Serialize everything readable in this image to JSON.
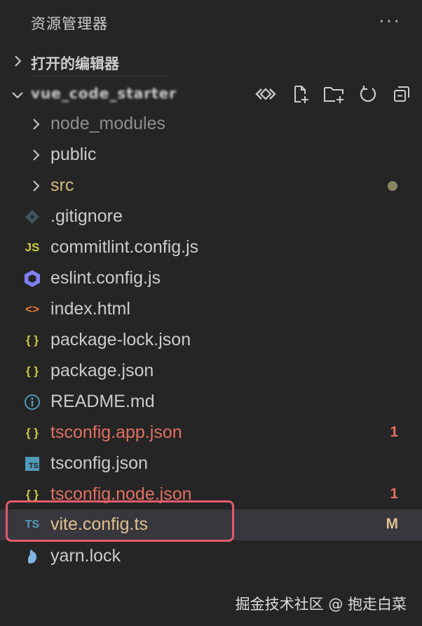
{
  "header": {
    "title": "资源管理器",
    "more_icon": "more-dots-icon"
  },
  "open_editors": {
    "label": "打开的编辑器"
  },
  "project": {
    "title": "vue_code_starter"
  },
  "toolbar": {
    "icons": [
      "source-control-icon",
      "new-file-icon",
      "new-folder-icon",
      "refresh-icon",
      "collapse-all-icon"
    ]
  },
  "tree": [
    {
      "type": "folder",
      "label": "node_modules",
      "color": "#8e8e8e"
    },
    {
      "type": "folder",
      "label": "public",
      "color": "#cccccc"
    },
    {
      "type": "folder",
      "label": "src",
      "color": "#d7ba7d",
      "modified_dot": true
    },
    {
      "type": "file",
      "label": ".gitignore",
      "icon": "git-icon",
      "color": "#cccccc"
    },
    {
      "type": "file",
      "label": "commitlint.config.js",
      "icon": "js-icon",
      "icon_text": "JS",
      "color": "#cccccc"
    },
    {
      "type": "file",
      "label": "eslint.config.js",
      "icon": "eslint-icon",
      "color": "#cccccc"
    },
    {
      "type": "file",
      "label": "index.html",
      "icon": "html-icon",
      "icon_text": "<>",
      "color": "#cccccc"
    },
    {
      "type": "file",
      "label": "package-lock.json",
      "icon": "json-icon",
      "icon_text": "{ }",
      "color": "#cccccc"
    },
    {
      "type": "file",
      "label": "package.json",
      "icon": "json-icon",
      "icon_text": "{ }",
      "color": "#cccccc"
    },
    {
      "type": "file",
      "label": "README.md",
      "icon": "info-icon",
      "color": "#cccccc"
    },
    {
      "type": "file",
      "label": "tsconfig.app.json",
      "icon": "json-icon",
      "icon_text": "{ }",
      "color": "#e2705f",
      "badge": "1"
    },
    {
      "type": "file",
      "label": "tsconfig.json",
      "icon": "tsconfig-icon",
      "icon_text": "TS",
      "color": "#cccccc"
    },
    {
      "type": "file",
      "label": "tsconfig.node.json",
      "icon": "json-icon",
      "icon_text": "{ }",
      "color": "#e2705f",
      "badge": "1"
    },
    {
      "type": "file",
      "label": "vite.config.ts",
      "icon": "ts-icon",
      "icon_text": "TS",
      "color": "#e2c08d",
      "badge": "M",
      "selected": true
    },
    {
      "type": "file",
      "label": "yarn.lock",
      "icon": "yarn-icon",
      "color": "#cccccc"
    }
  ],
  "colors": {
    "background": "#252526",
    "selected_row": "#37373d",
    "error_text": "#e2705f",
    "modified_text": "#e2c08d",
    "highlight_border": "#e35b6c",
    "json_icon": "#cbcb41",
    "js_icon": "#cbcb41",
    "html_icon": "#e37933",
    "ts_icon": "#519aba",
    "eslint_icon": "#8080f2"
  },
  "watermark": "掘金技术社区 @ 抱走白菜"
}
